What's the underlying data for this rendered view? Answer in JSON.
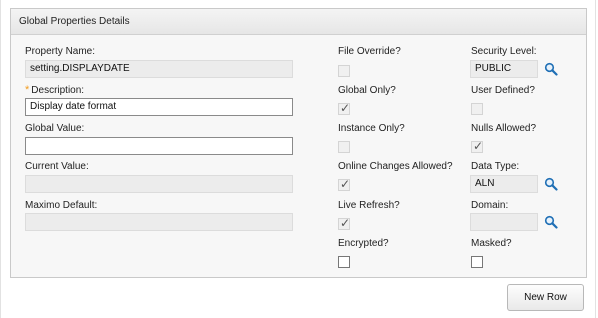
{
  "panel": {
    "title": "Global Properties Details"
  },
  "col1": {
    "property_name": {
      "label": "Property Name:",
      "value": "setting.DISPLAYDATE"
    },
    "description": {
      "required_mark": "*",
      "label": "Description:",
      "value": "Display date format"
    },
    "global_value": {
      "label": "Global Value:",
      "value": ""
    },
    "current_value": {
      "label": "Current Value:",
      "value": ""
    },
    "maximo_default": {
      "label": "Maximo Default:",
      "value": ""
    }
  },
  "col2": {
    "file_override": {
      "label": "File Override?",
      "checked": false,
      "editable": false
    },
    "global_only": {
      "label": "Global Only?",
      "checked": true,
      "editable": false
    },
    "instance_only": {
      "label": "Instance Only?",
      "checked": false,
      "editable": false
    },
    "online_changes": {
      "label": "Online Changes Allowed?",
      "checked": true,
      "editable": false
    },
    "live_refresh": {
      "label": "Live Refresh?",
      "checked": true,
      "editable": false
    },
    "encrypted": {
      "label": "Encrypted?",
      "checked": false,
      "editable": true
    }
  },
  "col3": {
    "security_level": {
      "label": "Security Level:",
      "value": "PUBLIC"
    },
    "user_defined": {
      "label": "User Defined?",
      "checked": false,
      "editable": false
    },
    "nulls_allowed": {
      "label": "Nulls Allowed?",
      "checked": true,
      "editable": false
    },
    "data_type": {
      "label": "Data Type:",
      "value": "ALN"
    },
    "domain": {
      "label": "Domain:",
      "value": ""
    },
    "masked": {
      "label": "Masked?",
      "checked": false,
      "editable": true
    }
  },
  "actions": {
    "new_row": "New Row"
  },
  "icons": {
    "lookup": "magnifier-icon",
    "check": "checkmark-icon"
  },
  "colors": {
    "required": "#f29b1d",
    "lookup_icon": "#1f6fb5"
  }
}
